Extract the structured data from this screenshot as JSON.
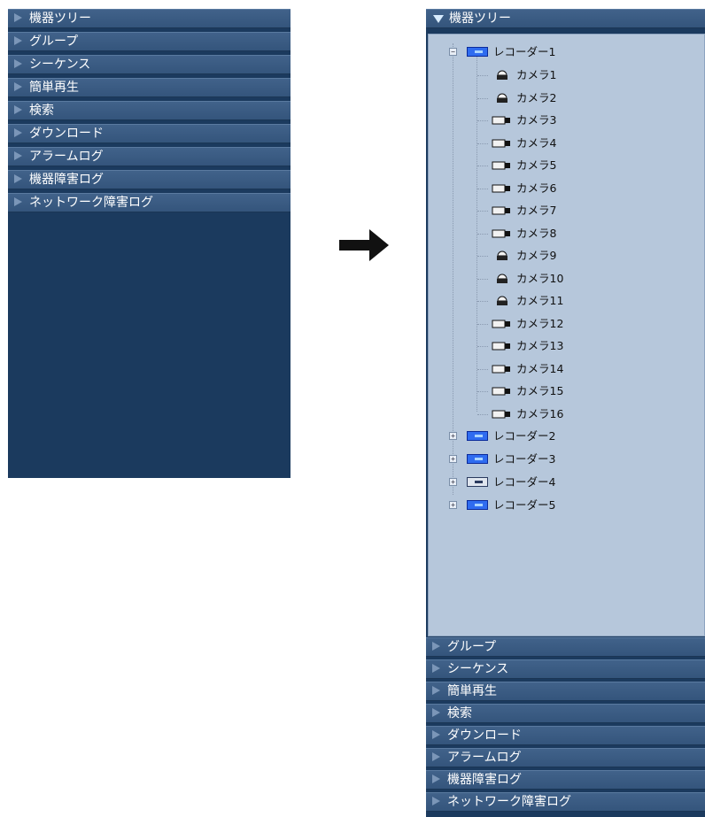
{
  "left_menu": {
    "items": [
      {
        "label": "機器ツリー"
      },
      {
        "label": "グループ"
      },
      {
        "label": "シーケンス"
      },
      {
        "label": "簡単再生"
      },
      {
        "label": "検索"
      },
      {
        "label": "ダウンロード"
      },
      {
        "label": "アラームログ"
      },
      {
        "label": "機器障害ログ"
      },
      {
        "label": "ネットワーク障害ログ"
      }
    ]
  },
  "right_menu": {
    "header": {
      "label": "機器ツリー",
      "state": "expanded"
    },
    "tree": {
      "recorders": [
        {
          "label": "レコーダー1",
          "expanded": true,
          "status": "online",
          "cameras": [
            {
              "label": "カメラ1",
              "icon": "dome-camera-icon"
            },
            {
              "label": "カメラ2",
              "icon": "dome-camera-icon"
            },
            {
              "label": "カメラ3",
              "icon": "box-camera-icon"
            },
            {
              "label": "カメラ4",
              "icon": "box-camera-icon"
            },
            {
              "label": "カメラ5",
              "icon": "box-camera-icon"
            },
            {
              "label": "カメラ6",
              "icon": "box-camera-icon"
            },
            {
              "label": "カメラ7",
              "icon": "box-camera-icon"
            },
            {
              "label": "カメラ8",
              "icon": "box-camera-icon"
            },
            {
              "label": "カメラ9",
              "icon": "dome-camera-icon"
            },
            {
              "label": "カメラ10",
              "icon": "dome-camera-icon"
            },
            {
              "label": "カメラ11",
              "icon": "dome-camera-icon"
            },
            {
              "label": "カメラ12",
              "icon": "box-camera-icon"
            },
            {
              "label": "カメラ13",
              "icon": "box-camera-icon"
            },
            {
              "label": "カメラ14",
              "icon": "box-camera-icon"
            },
            {
              "label": "カメラ15",
              "icon": "box-camera-icon"
            },
            {
              "label": "カメラ16",
              "icon": "box-camera-icon"
            }
          ]
        },
        {
          "label": "レコーダー2",
          "expanded": false,
          "status": "online"
        },
        {
          "label": "レコーダー3",
          "expanded": false,
          "status": "online"
        },
        {
          "label": "レコーダー4",
          "expanded": false,
          "status": "offline"
        },
        {
          "label": "レコーダー5",
          "expanded": false,
          "status": "online"
        }
      ]
    },
    "items": [
      {
        "label": "グループ"
      },
      {
        "label": "シーケンス"
      },
      {
        "label": "簡単再生"
      },
      {
        "label": "検索"
      },
      {
        "label": "ダウンロード"
      },
      {
        "label": "アラームログ"
      },
      {
        "label": "機器障害ログ"
      },
      {
        "label": "ネットワーク障害ログ"
      }
    ]
  },
  "colors": {
    "menu_bar": "#3a5c84",
    "panel_bg": "#1b3a5e",
    "tree_bg": "#b6c7db",
    "recorder_icon": "#2f6cf0",
    "arrow": "#111111"
  },
  "icons": {
    "collapsed_item": "triangle-right-icon",
    "expanded_item": "triangle-down-icon",
    "transition_arrow": "right-arrow-icon"
  }
}
